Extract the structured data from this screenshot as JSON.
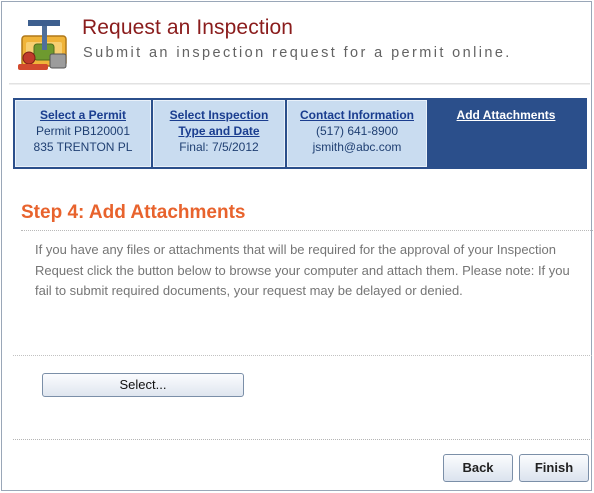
{
  "header": {
    "title": "Request an Inspection",
    "subtitle": "Submit an inspection request for a permit online.",
    "logo_icon": "tools-icon"
  },
  "steps": [
    {
      "label": "Select a Permit",
      "lines": [
        "Permit PB120001",
        "835 TRENTON PL"
      ],
      "active": false
    },
    {
      "label": "Select Inspection Type and Date",
      "label_lines": [
        "Select Inspection",
        "Type and Date"
      ],
      "lines": [
        "Final: 7/5/2012"
      ],
      "active": false
    },
    {
      "label": "Contact Information",
      "lines": [
        "(517) 641-8900",
        "jsmith@abc.com"
      ],
      "active": false
    },
    {
      "label": "Add Attachments",
      "lines": [],
      "active": true
    }
  ],
  "main": {
    "heading": "Step 4: Add Attachments",
    "description": "If you have any files or attachments that will be required for the approval of your Inspection Request click the button below to browse your computer and attach them. Please note: If you fail to submit required documents, your request may be delayed or denied.",
    "select_label": "Select..."
  },
  "footer": {
    "back_label": "Back",
    "finish_label": "Finish"
  },
  "colors": {
    "title": "#8a1c1c",
    "heading": "#e8632d",
    "steps_bar": "#2b4f8b",
    "step_inactive": "#c9dcf0"
  }
}
